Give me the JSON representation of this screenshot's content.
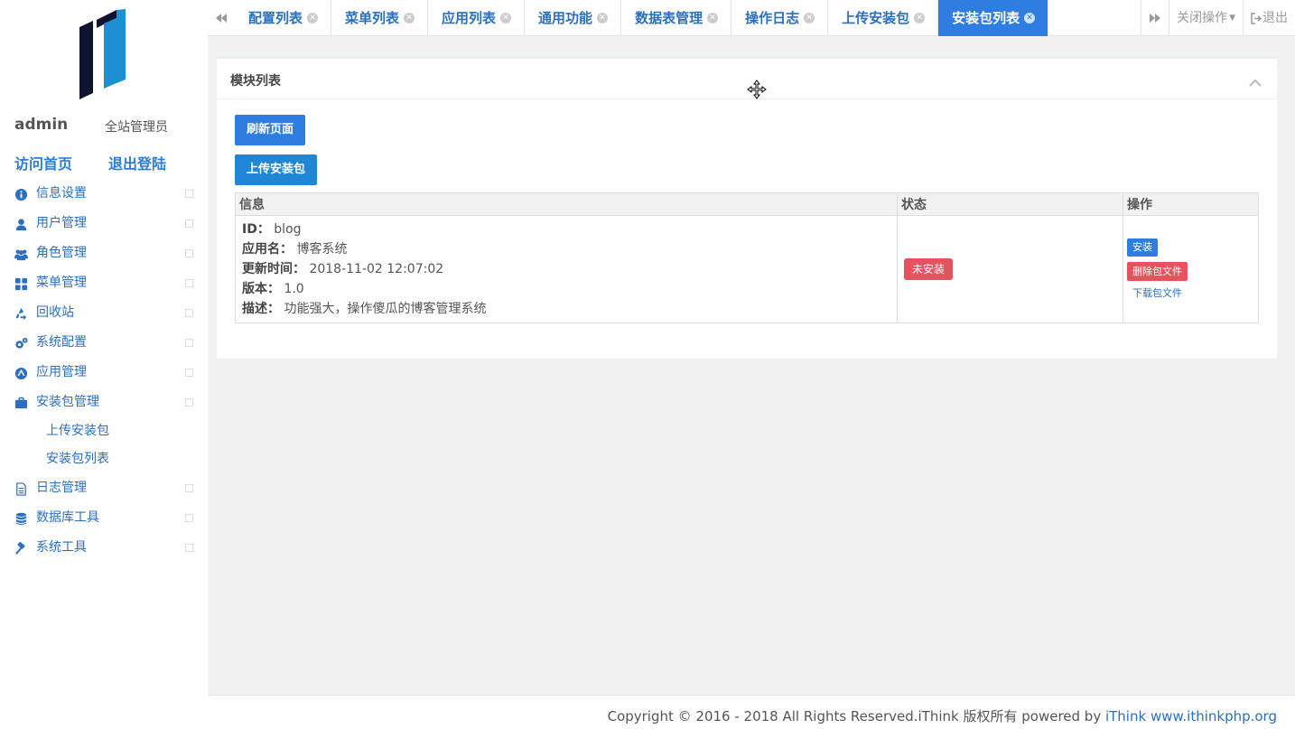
{
  "sidebar": {
    "user_name": "admin",
    "user_role": "全站管理员",
    "visit_home": "访问首页",
    "logout": "退出登陆",
    "items": [
      {
        "label": "信息设置",
        "icon": "info-circle-icon"
      },
      {
        "label": "用户管理",
        "icon": "user-icon"
      },
      {
        "label": "角色管理",
        "icon": "users-icon"
      },
      {
        "label": "菜单管理",
        "icon": "grid-icon"
      },
      {
        "label": "回收站",
        "icon": "recycle-icon"
      },
      {
        "label": "系统配置",
        "icon": "gears-icon"
      },
      {
        "label": "应用管理",
        "icon": "app-icon"
      },
      {
        "label": "安装包管理",
        "icon": "briefcase-icon"
      },
      {
        "label": "日志管理",
        "icon": "file-text-icon"
      },
      {
        "label": "数据库工具",
        "icon": "database-icon"
      },
      {
        "label": "系统工具",
        "icon": "gavel-icon"
      }
    ],
    "subitems": [
      {
        "label": "上传安装包"
      },
      {
        "label": "安装包列表"
      }
    ]
  },
  "tabs": [
    {
      "label": "配置列表",
      "active": false
    },
    {
      "label": "菜单列表",
      "active": false
    },
    {
      "label": "应用列表",
      "active": false
    },
    {
      "label": "通用功能",
      "active": false
    },
    {
      "label": "数据表管理",
      "active": false
    },
    {
      "label": "操作日志",
      "active": false
    },
    {
      "label": "上传安装包",
      "active": false
    },
    {
      "label": "安装包列表",
      "active": true
    }
  ],
  "topbar": {
    "close_ops": "关闭操作",
    "exit": "退出"
  },
  "panel": {
    "title": "模块列表",
    "refresh_button": "刷新页面",
    "upload_button": "上传安装包",
    "table": {
      "headers": [
        "信息",
        "状态",
        "操作"
      ],
      "rows": [
        {
          "id_label": "ID：",
          "id": "blog",
          "name_label": "应用名：",
          "name": "博客系统",
          "updated_label": "更新时间：",
          "updated": "2018-11-02 12:07:02",
          "version_label": "版本：",
          "version": "1.0",
          "desc_label": "描述：",
          "desc": "功能强大，操作傻瓜的博客管理系统",
          "status": "未安装",
          "op_install": "安装",
          "op_delete": "删除包文件",
          "op_download": "下载包文件"
        }
      ]
    }
  },
  "footer": {
    "text": "Copyright © 2016 - 2018 All Rights Reserved.iThink 版权所有 powered by ",
    "link1": "iThink",
    "link2": "www.ithinkphp.org"
  },
  "colors": {
    "accent": "#2e7de0",
    "danger": "#e5535e",
    "link": "#2b6fc0"
  }
}
